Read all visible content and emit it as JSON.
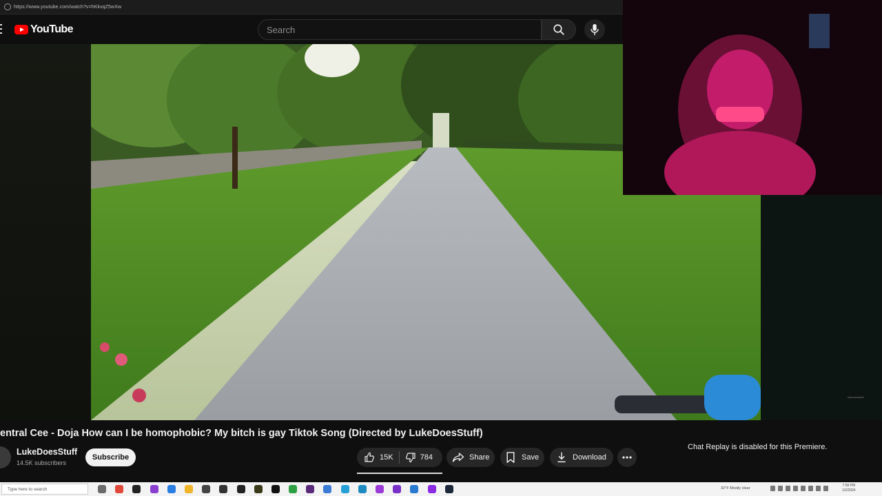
{
  "browser": {
    "url": "https://www.youtube.com/watch?v=hKkvqZ5wXw"
  },
  "header": {
    "logo_text": "YouTube",
    "search_placeholder": "Search"
  },
  "video": {
    "title": "entral Cee - Doja How can I be homophobic? My bitch is gay Tiktok Song (Directed by LukeDoesStuff)",
    "corner_label": "lukedoesstuff"
  },
  "channel": {
    "name": "LukeDoesStuff",
    "subscribers": "14.5K subscribers",
    "subscribe_label": "Subscribe"
  },
  "actions": {
    "likes": "15K",
    "dislikes": "784",
    "share": "Share",
    "save": "Save",
    "download": "Download"
  },
  "chat": {
    "notice": "Chat Replay is disabled for this Premiere."
  },
  "taskbar": {
    "search_placeholder": "Type here to search",
    "weather": "32°F  Mostly clear",
    "time": "7:58 PM",
    "date": "1/2/2024"
  },
  "colors": {
    "youtube_red": "#ff0000",
    "background": "#0f0f0f",
    "pill": "#272727",
    "taskbar": "#f3f3f3"
  }
}
